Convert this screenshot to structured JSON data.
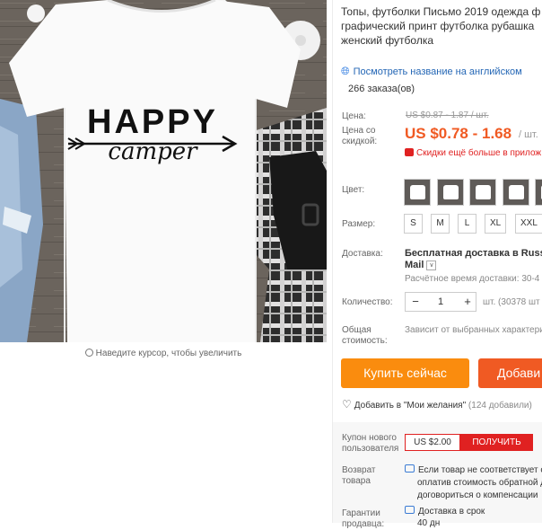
{
  "product": {
    "title": "Топы, футболки Письмо 2019 одежда ф графический принт футболка рубашка женский футболка",
    "translate_link": "Посмотреть название на английском",
    "orders": "266 заказа(ов)",
    "image_text_line1": "HAPPY",
    "image_text_line2": "camper",
    "zoom_hint": "Наведите курсор, чтобы увеличить"
  },
  "price": {
    "label": "Цена:",
    "original": "US $0.87 - 1.87 / шт.",
    "discount_label": "Цена со скидкой:",
    "discounted": "US $0.78 - 1.68",
    "unit": "/ шт.",
    "promo": "Скидки ещё больше в прилож"
  },
  "options": {
    "color_label": "Цвет:",
    "color_count": 5,
    "size_label": "Размер:",
    "sizes": [
      "S",
      "M",
      "L",
      "XL",
      "XXL"
    ]
  },
  "shipping": {
    "label": "Доставка:",
    "main": "Бесплатная доставка в Russian",
    "method": "Mail",
    "time": "Расчётное время доставки: 30-4"
  },
  "quantity": {
    "label": "Количество:",
    "minus": "−",
    "value": "1",
    "plus": "+",
    "stock": "шт. (30378 шт"
  },
  "total": {
    "label": "Общая стоимость:",
    "value": "Зависит от выбранных характери"
  },
  "actions": {
    "buy_now": "Купить сейчас",
    "add_cart": "Добави",
    "wishlist": "Добавить в \"Мои желания\"",
    "wishlist_count": "(124 добавили)"
  },
  "coupon": {
    "label": "Купон нового пользователя",
    "value": "US $2.00",
    "button": "ПОЛУЧИТЬ"
  },
  "returns": {
    "label": "Возврат товара",
    "line1": "Если товар не соответствует о",
    "line2": "оплатив стоимость обратной д",
    "line3": "договориться о компенсации"
  },
  "guarantee": {
    "label": "Гарантии продавца:",
    "line1": "Доставка в срок",
    "line2": "40 дн"
  },
  "colors": {
    "price": "#f05a23",
    "buy_now": "#fa8c0e",
    "add_cart": "#f05a23",
    "coupon": "#e02121",
    "link": "#2366b5"
  }
}
